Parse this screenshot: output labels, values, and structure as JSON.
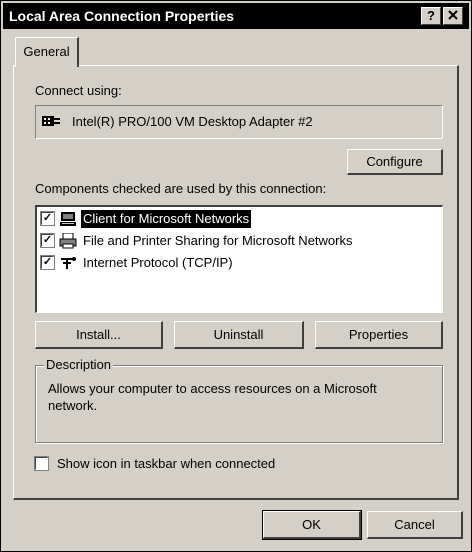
{
  "window": {
    "title": "Local Area Connection Properties",
    "help_glyph": "?",
    "close_glyph": "X"
  },
  "tabs": [
    {
      "label": "General",
      "active": true
    }
  ],
  "connect_using": {
    "label": "Connect using:",
    "adapter": "Intel(R) PRO/100 VM Desktop Adapter #2",
    "adapter_icon": "network-adapter-icon",
    "configure_label": "Configure"
  },
  "components": {
    "label": "Components checked are used by this connection:",
    "items": [
      {
        "label": "Client for Microsoft Networks",
        "checked": true,
        "selected": true,
        "icon": "client-icon"
      },
      {
        "label": "File and Printer Sharing for Microsoft Networks",
        "checked": true,
        "selected": false,
        "icon": "file-printer-sharing-icon"
      },
      {
        "label": "Internet Protocol (TCP/IP)",
        "checked": true,
        "selected": false,
        "icon": "protocol-icon"
      }
    ],
    "install_label": "Install...",
    "uninstall_label": "Uninstall",
    "properties_label": "Properties"
  },
  "description": {
    "legend": "Description",
    "text": "Allows your computer to access resources on a Microsoft network."
  },
  "show_icon": {
    "label": "Show icon in taskbar when connected",
    "checked": false
  },
  "footer": {
    "ok_label": "OK",
    "cancel_label": "Cancel"
  },
  "colors": {
    "face": "#d4d0c8",
    "titlebar": "#000000",
    "selection": "#000000"
  }
}
